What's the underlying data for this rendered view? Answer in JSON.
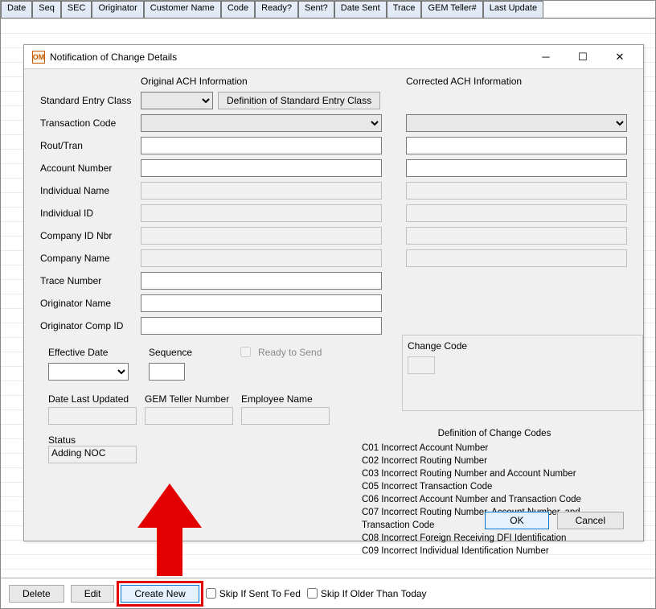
{
  "columns": [
    "Date",
    "Seq",
    "SEC",
    "Originator",
    "Customer Name",
    "Code",
    "Ready?",
    "Sent?",
    "Date Sent",
    "Trace",
    "GEM Teller#",
    "Last Update"
  ],
  "bottombar": {
    "delete": "Delete",
    "edit": "Edit",
    "create_new": "Create New",
    "skip_sent": "Skip If Sent To Fed",
    "skip_older": "Skip If Older Than Today"
  },
  "dialog": {
    "title": "Notification of Change Details",
    "section_original": "Original ACH Information",
    "section_corrected": "Corrected ACH Information",
    "labels": {
      "sec": "Standard Entry Class",
      "defbtn": "Definition of Standard Entry Class",
      "txncode": "Transaction Code",
      "rout": "Rout/Tran",
      "acct": "Account Number",
      "indname": "Individual Name",
      "indid": "Individual ID",
      "compidnbr": "Company ID Nbr",
      "compname": "Company Name",
      "trace": "Trace Number",
      "origname": "Originator Name",
      "origcomp": "Originator Comp ID",
      "effdate": "Effective Date",
      "sequence": "Sequence",
      "ready": "Ready to Send",
      "lastupd": "Date Last Updated",
      "gemteller": "GEM Teller Number",
      "empname": "Employee Name",
      "status": "Status",
      "status_value": "Adding NOC",
      "changecode": "Change Code",
      "codes_title": "Definition of Change Codes"
    },
    "codes": [
      "C01 Incorrect Account Number",
      "C02 Incorrect Routing Number",
      "C03 Incorrect Routing Number and Account Number",
      "C05 Incorrect Transaction Code",
      "C06 Incorrect Account Number and Transaction Code",
      "C07 Incorrect Routing Number, Account Number, and Transaction Code",
      "C08 Incorrect Foreign Receiving DFI Identification",
      "C09 Incorrect Individual Identification Number"
    ],
    "ok": "OK",
    "cancel": "Cancel"
  }
}
